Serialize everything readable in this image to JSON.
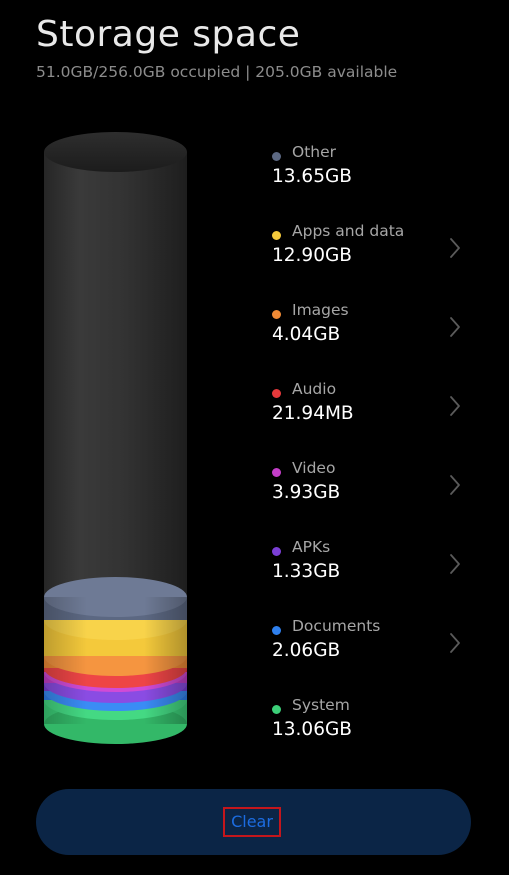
{
  "header": {
    "title": "Storage space",
    "summary": "51.0GB/256.0GB occupied | 205.0GB available"
  },
  "categories": [
    {
      "name": "Other",
      "size": "13.65GB",
      "color": "#5c6882",
      "has_chevron": false
    },
    {
      "name": "Apps and data",
      "size": "12.90GB",
      "color": "#f4c93b",
      "has_chevron": true
    },
    {
      "name": "Images",
      "size": "4.04GB",
      "color": "#f08a35",
      "has_chevron": true
    },
    {
      "name": "Audio",
      "size": "21.94MB",
      "color": "#e6393b",
      "has_chevron": true
    },
    {
      "name": "Video",
      "size": "3.93GB",
      "color": "#c43ec9",
      "has_chevron": true
    },
    {
      "name": "APKs",
      "size": "1.33GB",
      "color": "#7b3fd6",
      "has_chevron": true
    },
    {
      "name": "Documents",
      "size": "2.06GB",
      "color": "#2f80ee",
      "has_chevron": true
    },
    {
      "name": "System",
      "size": "13.06GB",
      "color": "#3ccf78",
      "has_chevron": false
    }
  ],
  "icons": {
    "chevron": "chevron-right-icon",
    "dot": "category-dot"
  },
  "actions": {
    "clear_label": "Clear"
  },
  "colors": {
    "background": "#000000",
    "button_bg": "#0b2546",
    "button_text": "#1c6ce0",
    "highlight_border": "#c4161c"
  }
}
